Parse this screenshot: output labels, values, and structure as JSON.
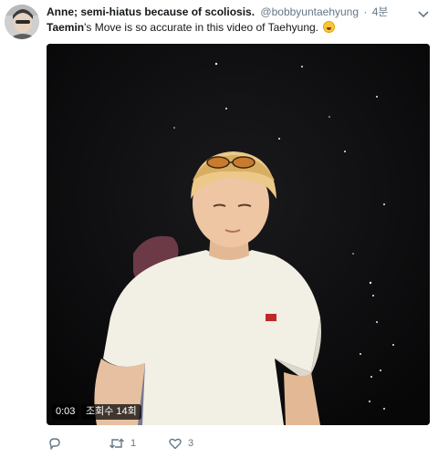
{
  "author": {
    "display_name": "Anne; semi-hiatus because of scoliosis.",
    "handle": "@bobbyuntaehyung",
    "separator": "·",
    "time": "4분"
  },
  "tweet": {
    "mention": "Taemin",
    "text": "'s Move is so accurate in this video of Taehyung.",
    "emoji": "face-with-tears-of-joy"
  },
  "video": {
    "duration": "0:03",
    "views": "조회수 14회"
  },
  "actions": {
    "reply_count": "",
    "retweet_count": "1",
    "like_count": "3"
  }
}
